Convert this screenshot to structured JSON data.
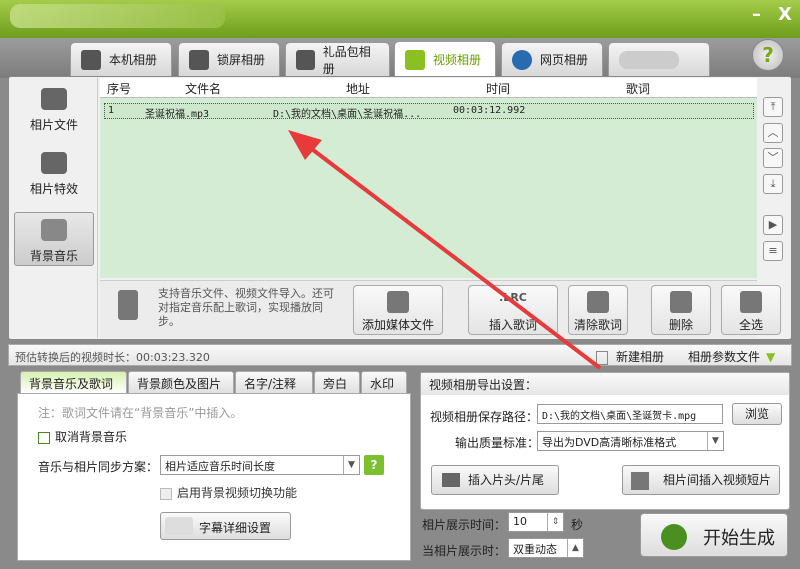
{
  "window": {
    "minimize": "–",
    "close": "X"
  },
  "tabs": [
    {
      "label": "本机相册"
    },
    {
      "label": "锁屏相册"
    },
    {
      "label": "礼品包相册"
    },
    {
      "label": "视频相册"
    },
    {
      "label": "网页相册"
    },
    {
      "label": ""
    }
  ],
  "help": "?",
  "sidebar": {
    "items": [
      {
        "label": "相片文件"
      },
      {
        "label": "相片特效"
      },
      {
        "label": "背景音乐"
      }
    ]
  },
  "list": {
    "headers": [
      "序号",
      "文件名",
      "地址",
      "时间",
      "歌词"
    ],
    "rows": [
      {
        "index": "1",
        "name": "圣诞祝福.mp3",
        "path": "D:\\我的文档\\桌面\\圣诞祝福...",
        "time": "00:03:12.992",
        "lyrics": ""
      }
    ]
  },
  "scroll": [
    "⤒",
    "︿",
    "﹀",
    "⤓",
    "▶",
    "≡"
  ],
  "toolbar": {
    "hint": "支持音乐文件、视频文件导入。还可对指定音乐配上歌词，实现播放同步。",
    "add_media": "添加媒体文件",
    "insert_lyrics": "插入歌词",
    "clear_lyrics": "清除歌词",
    "delete": "删除",
    "select_all": "全选",
    "lrc_badge": ".LRC"
  },
  "status": {
    "duration_label": "预估转换后的视频时长：",
    "duration": "00:03:23.320",
    "new_album": "新建相册",
    "album_params": "相册参数文件"
  },
  "bottom_tabs": [
    "背景音乐及歌词",
    "背景颜色及图片",
    "名字/注释",
    "旁白",
    "水印"
  ],
  "music_panel": {
    "note": "注：歌词文件请在“背景音乐”中插入。",
    "cancel_bg_music": "取消背景音乐",
    "sync_label": "音乐与相片同步方案：",
    "sync_value": "相片适应音乐时间长度",
    "enable_bg_video": "启用背景视频切换功能",
    "subtitle_settings": "字幕详细设置"
  },
  "export": {
    "title": "视频相册导出设置：",
    "path_label": "视频相册保存路径：",
    "path": "D:\\我的文档\\桌面\\圣诞贺卡.mpg",
    "browse": "浏览",
    "quality_label": "输出质量标准：",
    "quality": "导出为DVD高清晰标准格式",
    "insert_head_tail": "插入片头/片尾",
    "insert_clip": "相片间插入视频短片"
  },
  "display": {
    "time_label": "相片展示时间：",
    "time_value": "10",
    "unit": "秒",
    "mode_label": "当相片展示时：",
    "mode_value": "双重动态"
  },
  "start": "开始生成"
}
